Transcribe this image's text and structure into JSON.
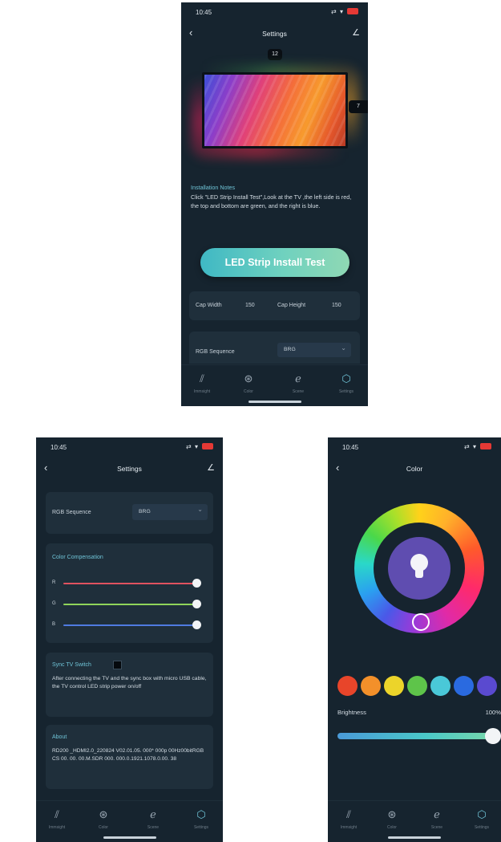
{
  "screens": {
    "installation": {
      "status": {
        "time": "10:45",
        "signal": "⇄ ▾",
        "battery": "■"
      },
      "nav": {
        "back": "‹",
        "title": "Settings",
        "edit": "∠"
      },
      "tv": {
        "top_count": "12",
        "side_count": "7"
      },
      "notes": {
        "title": "Installation Notes",
        "text": "Click \"LED Strip Install Test\",Look at the TV ,the left side is red, the top and bottom are green, and the right is blue."
      },
      "test_button": "LED Strip Install Test",
      "cap": {
        "width_label": "Cap Width",
        "width_value": "150",
        "height_label": "Cap Height",
        "height_value": "150"
      },
      "rgb": {
        "label": "RGB Sequence",
        "value": "BRG"
      }
    },
    "settings": {
      "status": {
        "time": "10:45",
        "signal": "⇄ ▾",
        "battery": "■"
      },
      "nav": {
        "back": "‹",
        "title": "Settings",
        "edit": "∠"
      },
      "rgb": {
        "label": "RGB Sequence",
        "value": "BRG"
      },
      "color_comp": {
        "title": "Color Compensation",
        "sliders": [
          {
            "label": "R",
            "level": 1.0,
            "color": "#e0525f"
          },
          {
            "label": "G",
            "level": 1.0,
            "color": "#8fd55a"
          },
          {
            "label": "B",
            "level": 1.0,
            "color": "#4f7be0"
          }
        ]
      },
      "sync": {
        "title": "Sync TV Switch",
        "text": "After connecting the TV and the sync box with micro USB cable, the TV control LED strip power on/off"
      },
      "about": {
        "title": "About",
        "text": "RD200 _HDMI2.0_220824 V02.01.05. 000* 000p 00Hz00bitRGB CS 00. 00. 00.M.SDR 000. 000.0.1921.1078.0.00. 38"
      }
    },
    "color": {
      "status": {
        "time": "10:45",
        "signal": "⇄ ▾",
        "battery": "■"
      },
      "nav": {
        "back": "‹",
        "title": "Color"
      },
      "brightness": {
        "label": "Brightness",
        "value": "100%",
        "level": 1.0
      },
      "swatches": [
        "#e8452a",
        "#f3902a",
        "#ecd42a",
        "#5ec44a",
        "#4ac8d8",
        "#2a6ae0",
        "#5a4ad0"
      ]
    }
  },
  "tabbar": {
    "items": [
      {
        "label": "Immsight",
        "icon": "diagonal-lines-icon",
        "glyph": "⫽"
      },
      {
        "label": "Color",
        "icon": "palette-icon",
        "glyph": "⊛"
      },
      {
        "label": "Scene",
        "icon": "scene-icon",
        "glyph": "ℯ"
      },
      {
        "label": "Settings",
        "icon": "settings-hex-icon",
        "glyph": "⬡"
      }
    ],
    "active": "Settings",
    "colors": {
      "active": "#6fc3d6",
      "inactive": "#9aa7b3"
    }
  },
  "colors": {
    "background": "#16242f",
    "card": "#1f2f3b",
    "accent": "#6fc3d6"
  }
}
